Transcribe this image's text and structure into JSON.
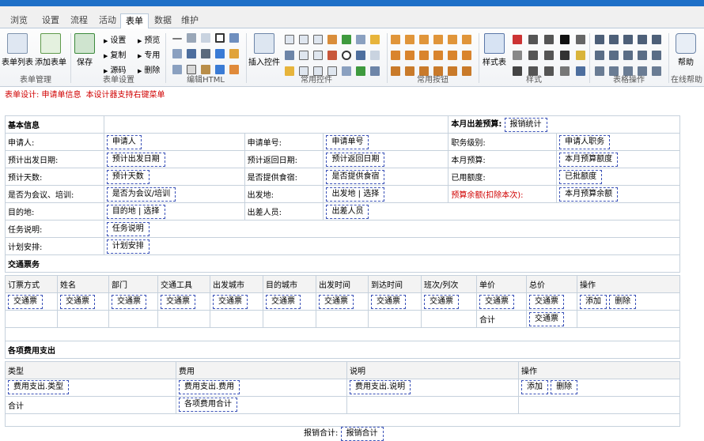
{
  "tabs": [
    "浏览",
    "设置",
    "流程",
    "活动",
    "表单",
    "数据",
    "维护"
  ],
  "ribbon": {
    "form_mgmt": {
      "list": "表单列表",
      "add": "添加表单",
      "label": "表单管理"
    },
    "form_settings": {
      "save": "保存",
      "settings": "设置",
      "copy": "复制",
      "source": "源码",
      "preview": "预览",
      "special": "专用",
      "delete": "删除",
      "label": "表单设置"
    },
    "edit_html": {
      "label": "编辑HTML"
    },
    "common_controls": {
      "insert": "插入控件",
      "label": "常用控件"
    },
    "common_buttons": {
      "label": "常用按钮"
    },
    "style": {
      "stylesheet": "样式表",
      "label": "样式"
    },
    "table_ops": {
      "label": "表格操作"
    },
    "help": {
      "help": "帮助",
      "label": "在线帮助"
    }
  },
  "hint": {
    "a": "表单设计: 申请单信息",
    "b": "本设计器支持右键菜单"
  },
  "basic": {
    "title": "基本信息",
    "budget_label": "本月出差预算:",
    "budget_field": "报销统计",
    "applicant": "申请人:",
    "applicant_f": "申请人",
    "apply_no": "申请单号:",
    "apply_no_f": "申请单号",
    "rank": "职务级别:",
    "rank_f": "申请人职务",
    "depart_date": "预计出发日期:",
    "depart_date_f": "预计出发日期",
    "return_date": "预计返回日期:",
    "return_date_f": "预计返回日期",
    "month_budget": "本月预算:",
    "month_budget_f": "本月预算额度",
    "days": "预计天数:",
    "days_f": "预计天数",
    "meals": "是否提供食宿:",
    "meals_f": "是否提供食宿",
    "used": "已用额度:",
    "used_f": "已批额度",
    "meeting": "是否为会议、培训:",
    "meeting_f": "是否为会议/培训",
    "origin": "出发地:",
    "origin_f": "出发地",
    "select": "选择",
    "remain": "预算余额(扣除本次):",
    "remain_f": "本月预算余额",
    "dest": "目的地:",
    "dest_f": "目的地",
    "people": "出差人员:",
    "people_f": "出差人员",
    "task": "任务说明:",
    "task_f": "任务说明",
    "plan": "计划安排:",
    "plan_f": "计划安排"
  },
  "tickets": {
    "title": "交通票务",
    "headers": [
      "订票方式",
      "姓名",
      "部门",
      "交通工具",
      "出发城市",
      "目的城市",
      "出发时间",
      "到达时间",
      "班次/列次",
      "单价",
      "总价",
      "操作"
    ],
    "cell": "交通票",
    "add": "添加",
    "del": "删除",
    "total": "合计",
    "total_f": "交通票"
  },
  "expenses": {
    "title": "各项费用支出",
    "headers": [
      "类型",
      "费用",
      "说明",
      "操作"
    ],
    "type_f": "费用支出.类型",
    "fee_f": "费用支出.费用",
    "note_f": "费用支出.说明",
    "add": "添加",
    "del": "删除",
    "total": "合计",
    "total_f": "各项费用合计"
  },
  "footer": {
    "label": "报销合计:",
    "field": "报销合计"
  }
}
